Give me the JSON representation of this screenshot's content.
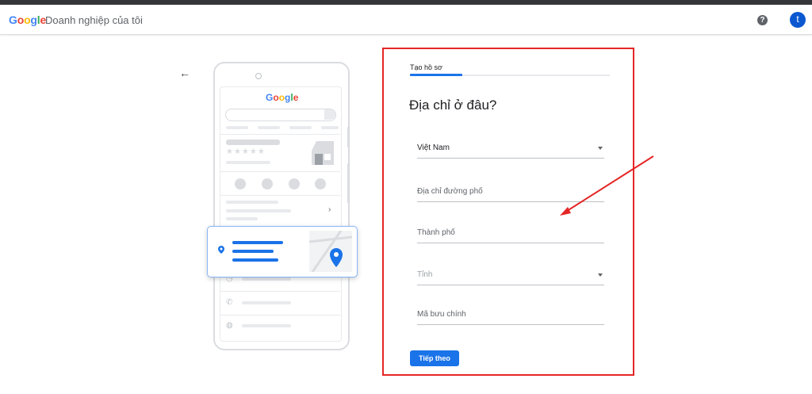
{
  "header": {
    "logo_letters": [
      "G",
      "o",
      "o",
      "g",
      "l",
      "e"
    ],
    "logo_colors": [
      "#4285f4",
      "#ea4335",
      "#fbbc05",
      "#4285f4",
      "#34a853",
      "#ea4335"
    ],
    "product_name": "Doanh nghiệp của tôi",
    "help_glyph": "?",
    "avatar_initial": "t"
  },
  "back_icon": "←",
  "illustration": {
    "search_engine": "Google",
    "stars": "★★★★★",
    "chevron": "›"
  },
  "form": {
    "tab_label": "Tạo hồ sơ",
    "progress": 0.26,
    "title": "Địa chỉ ở đâu?",
    "fields": {
      "country": "Việt Nam",
      "street": "Địa chỉ đường phố",
      "city": "Thành phố",
      "province": "Tỉnh",
      "postal": "Mã bưu chính"
    },
    "next_label": "Tiếp theo"
  },
  "colors": {
    "accent": "#1a73e8",
    "annotation_red": "#e52626"
  }
}
